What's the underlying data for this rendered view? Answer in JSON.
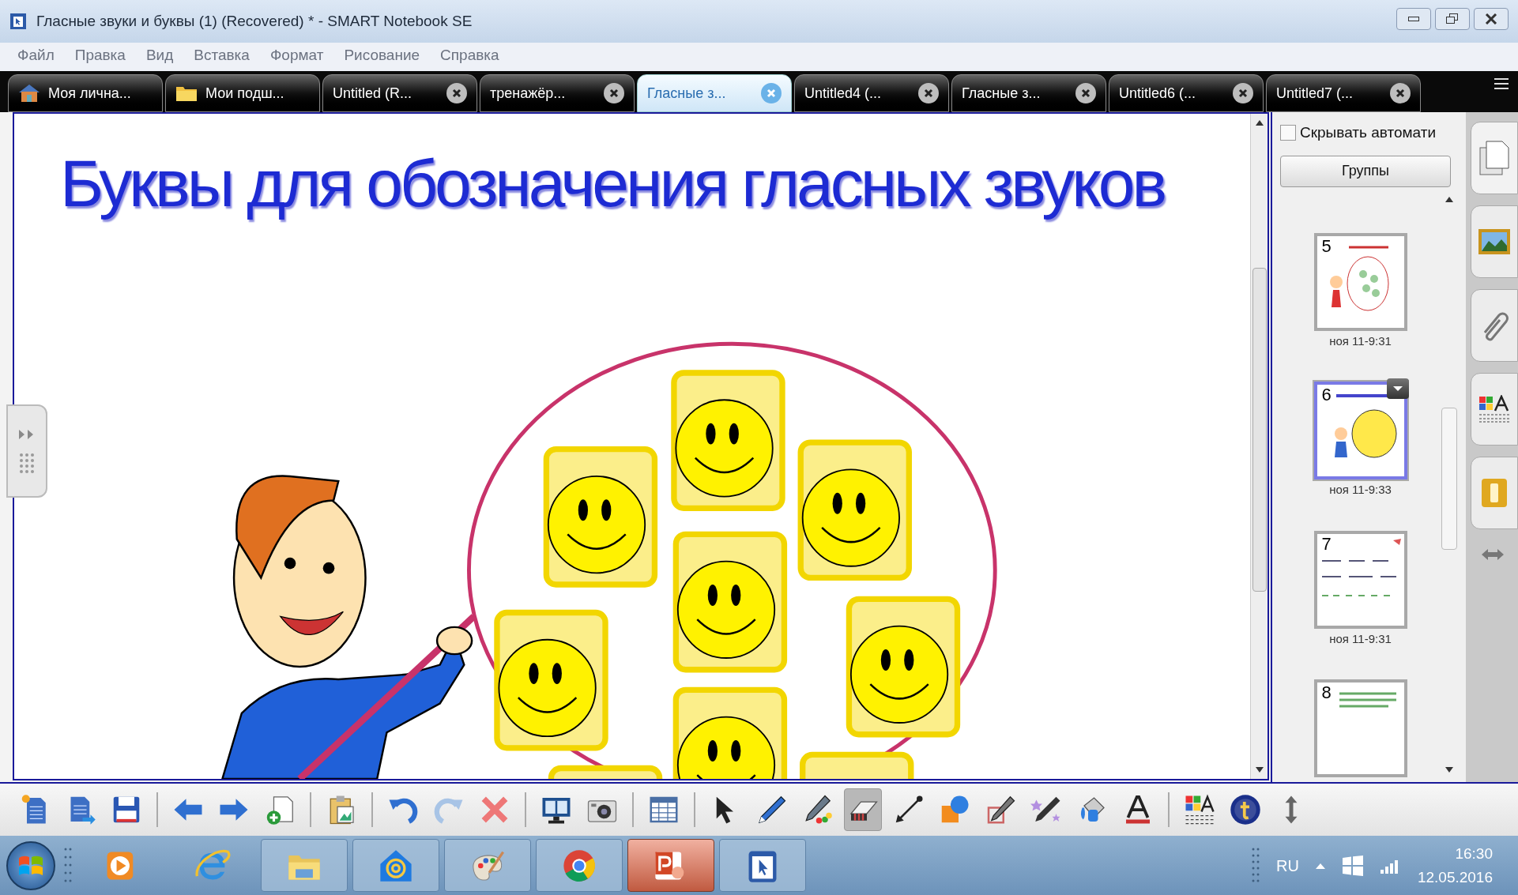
{
  "window": {
    "title": "Гласные звуки и буквы (1) (Recovered) * - SMART Notebook SE"
  },
  "menu": [
    "Файл",
    "Правка",
    "Вид",
    "Вставка",
    "Формат",
    "Рисование",
    "Справка"
  ],
  "tabs": [
    {
      "label": "Моя лична...",
      "kind": "home",
      "selected": false
    },
    {
      "label": "Мои подш...",
      "kind": "folder",
      "selected": false
    },
    {
      "label": "Untitled (R...",
      "kind": "document",
      "selected": false
    },
    {
      "label": "тренажёр...",
      "kind": "document",
      "selected": false
    },
    {
      "label": "Гласные з...",
      "kind": "document",
      "selected": true
    },
    {
      "label": "Untitled4 (...",
      "kind": "document",
      "selected": false
    },
    {
      "label": "Гласные з...",
      "kind": "document",
      "selected": false
    },
    {
      "label": "Untitled6 (...",
      "kind": "document",
      "selected": false
    },
    {
      "label": "Untitled7 (...",
      "kind": "document",
      "selected": false
    }
  ],
  "slide": {
    "title": "Буквы для обозначения гласных звуков"
  },
  "page_sorter": {
    "auto_hide": {
      "label": "Скрывать автомати",
      "checked": false
    },
    "groups_button": "Группы",
    "pages": [
      {
        "number": "5",
        "date": "ноя 11-9:31",
        "selected": false
      },
      {
        "number": "6",
        "date": "ноя 11-9:33",
        "selected": true
      },
      {
        "number": "7",
        "date": "ноя 11-9:31",
        "selected": false
      },
      {
        "number": "8",
        "selected": false
      }
    ]
  },
  "toolbar": {
    "tools": [
      {
        "kind": "tool",
        "selected": false
      },
      {
        "kind": "tool",
        "selected": false
      },
      {
        "kind": "tool",
        "selected": false
      },
      {
        "kind": "separator"
      },
      {
        "kind": "tool",
        "selected": false
      },
      {
        "kind": "tool",
        "selected": false
      },
      {
        "kind": "tool",
        "selected": false
      },
      {
        "kind": "separator"
      },
      {
        "kind": "tool",
        "selected": false
      },
      {
        "kind": "separator"
      },
      {
        "kind": "tool",
        "selected": false
      },
      {
        "kind": "tool",
        "selected": false
      },
      {
        "kind": "tool",
        "selected": false
      },
      {
        "kind": "separator"
      },
      {
        "kind": "tool",
        "selected": false
      },
      {
        "kind": "tool",
        "selected": false
      },
      {
        "kind": "separator"
      },
      {
        "kind": "tool",
        "selected": false
      },
      {
        "kind": "separator"
      },
      {
        "kind": "tool",
        "selected": false
      },
      {
        "kind": "tool",
        "selected": false
      },
      {
        "kind": "tool",
        "selected": false
      },
      {
        "kind": "tool",
        "selected": true
      },
      {
        "kind": "tool",
        "selected": false
      },
      {
        "kind": "tool",
        "selected": false
      },
      {
        "kind": "tool",
        "selected": false
      },
      {
        "kind": "tool",
        "selected": false
      },
      {
        "kind": "tool",
        "selected": false
      },
      {
        "kind": "tool",
        "selected": false
      },
      {
        "kind": "separator"
      },
      {
        "kind": "tool",
        "selected": false
      },
      {
        "kind": "tool",
        "selected": false
      },
      {
        "kind": "tool",
        "selected": false
      }
    ]
  },
  "taskbar": {
    "language": "RU",
    "time": "16:30",
    "date": "12.05.2016"
  }
}
